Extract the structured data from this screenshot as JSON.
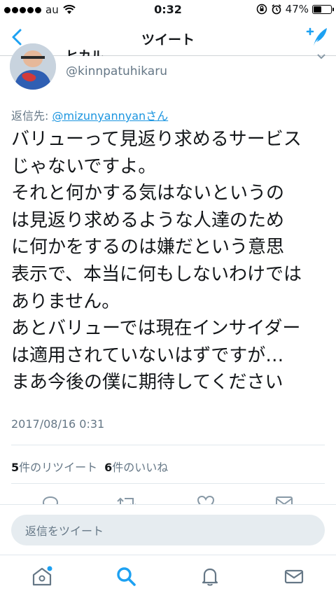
{
  "status_bar": {
    "carrier": "au",
    "time": "0:32",
    "battery": "47%",
    "battery_level": 0.47
  },
  "nav": {
    "title": "ツイート"
  },
  "tweet": {
    "name_partial": "ヒカル",
    "handle": "@kinnpatuhikaru",
    "reply_prefix": "返信先: ",
    "reply_mention": "@mizunyannyan",
    "reply_suffix": "さん",
    "text": "バリューって見返り求めるサービス\nじゃないですよ。\nそれと何かする気はないというの\nは見返り求めるような人達のため\nに何かをするのは嫌だという意思\n表示で、本当に何もしないわけでは\nありません。\nあとバリューでは現在インサイダー\nは適用されていないはずですが…\nまあ今後の僕に期待してください",
    "timestamp": "2017/08/16 0:31",
    "retweet_count": "5",
    "retweet_label": "件のリツイート",
    "like_count": "6",
    "like_label": "件のいいね"
  },
  "reply_bar": {
    "placeholder": "返信をツイート"
  },
  "colors": {
    "accent": "#1b95e0",
    "nav_blue": "#1da1f2",
    "muted": "#657786"
  }
}
